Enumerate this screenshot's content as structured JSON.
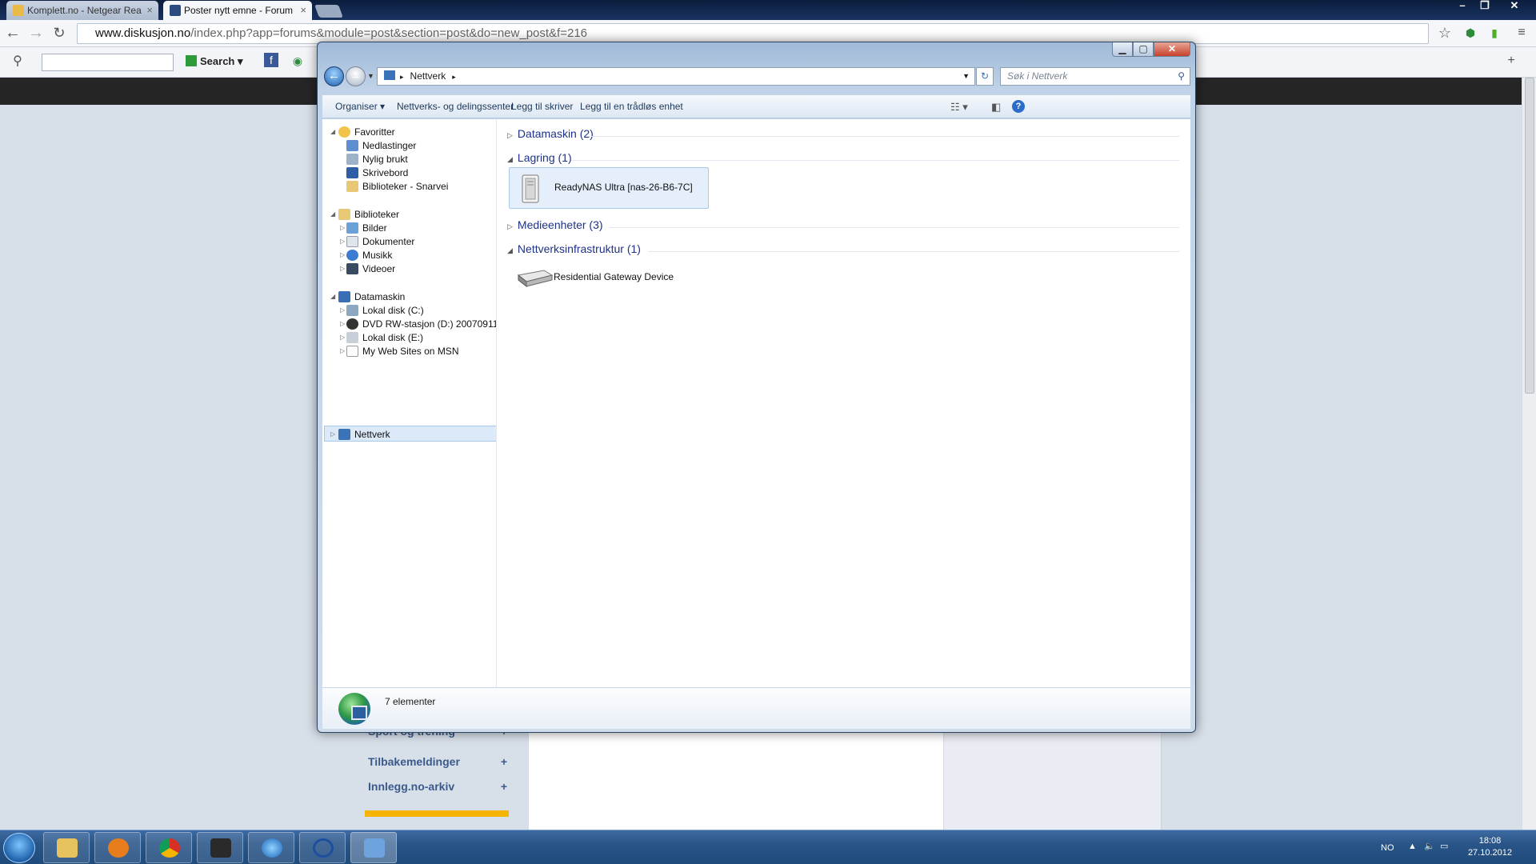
{
  "browser": {
    "tabs": [
      {
        "title": "Komplett.no - Netgear Rea",
        "active": false
      },
      {
        "title": "Poster nytt emne - Forum",
        "active": true
      }
    ],
    "url_domain": "www.diskusjon.no",
    "url_path": "/index.php?app=forums&module=post&section=post&do=new_post&f=216",
    "toolbar_search_label": "Search"
  },
  "forum_sidebar": {
    "items": [
      {
        "label": "Sport og trening"
      },
      {
        "label": "Tilbakemeldinger"
      },
      {
        "label": "Innlegg.no-arkiv"
      }
    ]
  },
  "explorer": {
    "address": "Nettverk",
    "search_placeholder": "Søk i Nettverk",
    "commands": {
      "organize": "Organiser",
      "network_center": "Nettverks- og delingssenter",
      "add_printer": "Legg til skriver",
      "add_wireless": "Legg til en trådløs enhet"
    },
    "nav": {
      "favorites": {
        "label": "Favoritter",
        "items": [
          "Nedlastinger",
          "Nylig brukt",
          "Skrivebord",
          "Biblioteker - Snarvei"
        ]
      },
      "libraries": {
        "label": "Biblioteker",
        "items": [
          "Bilder",
          "Dokumenter",
          "Musikk",
          "Videoer"
        ]
      },
      "computer": {
        "label": "Datamaskin",
        "items": [
          "Lokal disk (C:)",
          "DVD RW-stasjon (D:) 20070911",
          "Lokal disk (E:)",
          "My Web Sites on MSN"
        ]
      },
      "network": {
        "label": "Nettverk"
      }
    },
    "groups": [
      {
        "label": "Datamaskin (2)",
        "expanded": false
      },
      {
        "label": "Lagring (1)",
        "expanded": true
      },
      {
        "label": "Medieenheter (3)",
        "expanded": false
      },
      {
        "label": "Nettverksinfrastruktur (1)",
        "expanded": true
      }
    ],
    "devices": {
      "nas": "ReadyNAS Ultra [nas-26-B6-7C]",
      "gateway": "Residential Gateway Device"
    },
    "status": "7 elementer"
  },
  "taskbar": {
    "language": "NO",
    "time": "18:08",
    "date": "27.10.2012"
  },
  "colors": {
    "accent": "#1e3287",
    "selection": "#dbe9f8",
    "taskbar": "#2a5588"
  }
}
